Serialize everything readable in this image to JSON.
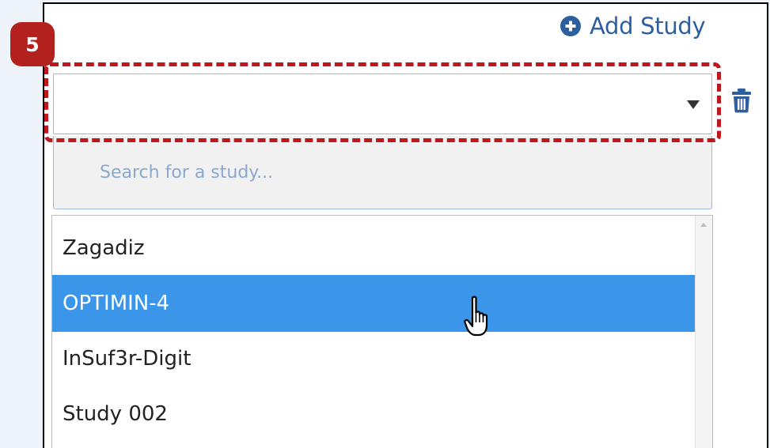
{
  "step_badge": "5",
  "add_study": {
    "label": "Add Study",
    "icon": "plus-circle-icon"
  },
  "study_select": {
    "value": "",
    "arrow_icon": "caret-down-icon"
  },
  "delete_icon": "trash-icon",
  "search": {
    "placeholder": "Search for a study...",
    "value": ""
  },
  "options": [
    {
      "label": "Zagadiz",
      "selected": false
    },
    {
      "label": "OPTIMIN-4",
      "selected": true
    },
    {
      "label": "InSuf3r-Digit",
      "selected": false
    },
    {
      "label": "Study 002",
      "selected": false
    }
  ],
  "colors": {
    "accent": "#2d5fa0",
    "highlight_dashes": "#c0161c",
    "badge": "#b3211e",
    "selected_row": "#3b96e9"
  },
  "cursor_icon": "hand-pointer-icon"
}
